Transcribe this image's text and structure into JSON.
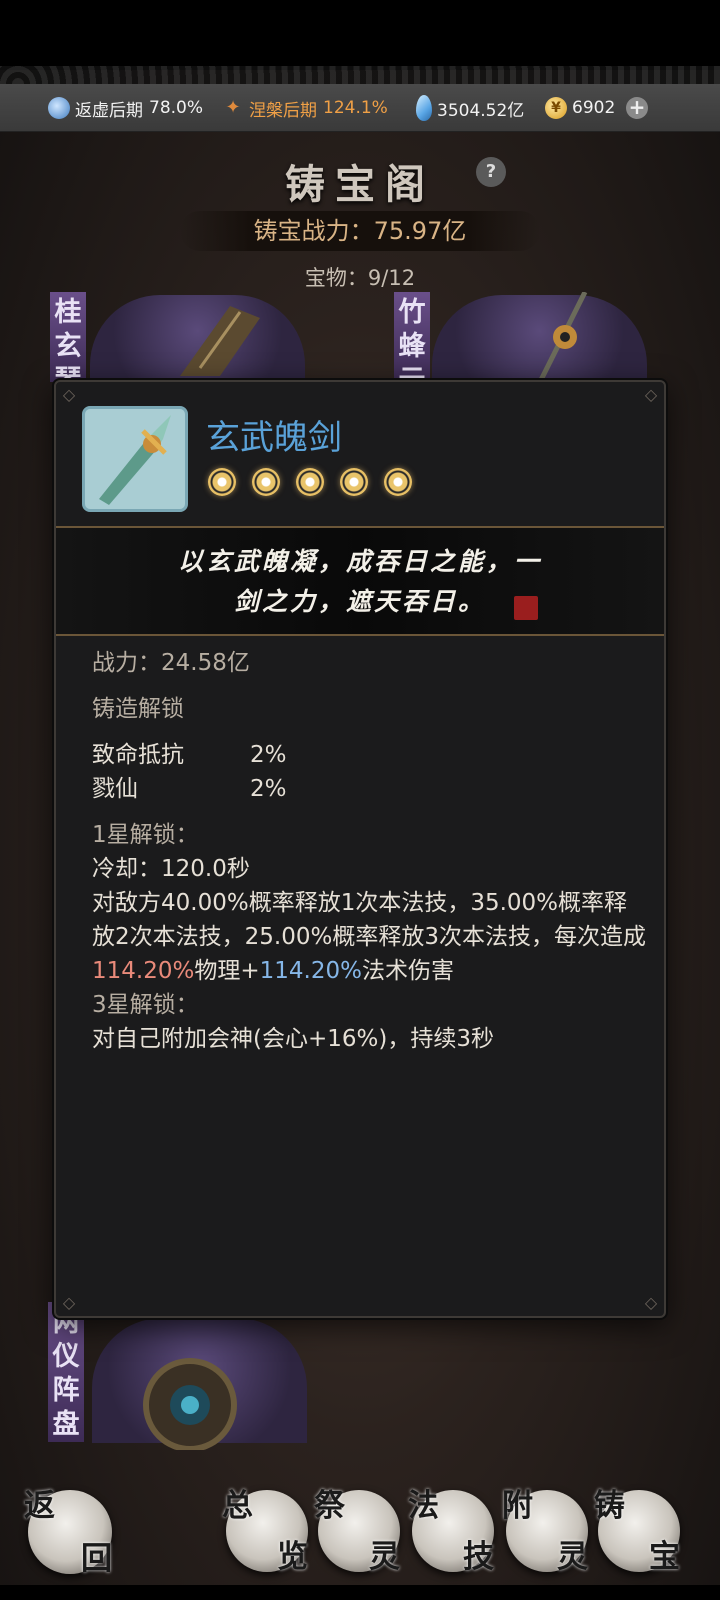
{
  "resources": {
    "realm1_label": "返虚后期",
    "realm1_value": "78.0%",
    "realm2_label": "涅槃后期",
    "realm2_value": "124.1%",
    "crystal_value": "3504.52亿",
    "coin_value": "6902"
  },
  "page": {
    "title": "铸宝阁",
    "help_label": "?",
    "power": "铸宝战力：75.97亿",
    "treasure_count": "宝物：9/12"
  },
  "background_cards": {
    "left_top": "桂玄琴",
    "right_top": "竹蜂云",
    "left_bottom": "两仪阵盘"
  },
  "detail": {
    "name": "玄武魄剑",
    "stars": 5,
    "quote_line1": "以玄武魄凝，成吞日之能，一",
    "quote_line2": "剑之力，遮天吞日。",
    "power_line": "战力：24.58亿",
    "forge_unlock_title": "铸造解锁",
    "stats": [
      {
        "name": "致命抵抗",
        "value": "2%"
      },
      {
        "name": "戮仙",
        "value": "2%"
      }
    ],
    "star1_title": "1星解锁：",
    "cooldown": "冷却：120.0秒",
    "skill_part1": "对敌方40.00%概率释放1次本法技，35.00%概率释放2次本法技，25.00%概率释放3次本法技，每次造成",
    "skill_phys": "114.20%",
    "skill_part2": "物理+",
    "skill_magic": "114.20%",
    "skill_part3": "法术伤害",
    "star3_title": "3星解锁：",
    "star3_desc": "对自己附加会神(会心+16%)，持续3秒"
  },
  "nav": [
    {
      "id": "back",
      "a": "返",
      "b": "回"
    },
    {
      "id": "overview",
      "a": "总",
      "b": "览"
    },
    {
      "id": "sacrifice",
      "a": "祭",
      "b": "灵"
    },
    {
      "id": "skill",
      "a": "法",
      "b": "技"
    },
    {
      "id": "attach",
      "a": "附",
      "b": "灵"
    },
    {
      "id": "forge",
      "a": "铸",
      "b": "宝"
    }
  ],
  "colors": {
    "name_blue": "#5aa2d8",
    "phys_red": "#e98a7a",
    "magic_blue": "#86b7e8",
    "realm2_orange": "#f0a046"
  }
}
